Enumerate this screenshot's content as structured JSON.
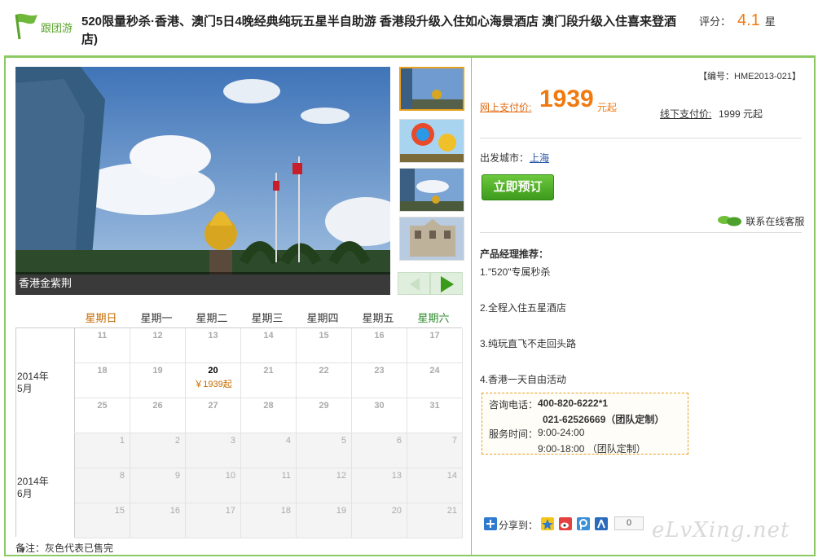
{
  "header": {
    "logo_text": "跟团游",
    "title": "520限量秒杀·香港、澳门5日4晚经典纯玩五星半自助游 香港段升级入住如心海景酒店 澳门段升级入住喜来登酒店)",
    "rating_label": "评分：",
    "rating_score": "4.1",
    "rating_unit": "星"
  },
  "gallery": {
    "caption": "香港金紫荆",
    "thumbnails": [
      "香港金紫荆",
      "热气球",
      "会展中心",
      "大三巴牌坊"
    ]
  },
  "calendar": {
    "weekdays": [
      "星期日",
      "星期一",
      "星期二",
      "星期三",
      "星期四",
      "星期五",
      "星期六"
    ],
    "months": [
      {
        "label_year": "2014年",
        "label_month": "5月",
        "weeks": [
          [
            "11",
            "12",
            "13",
            "14",
            "15",
            "16",
            "17"
          ],
          [
            "18",
            "19",
            "20",
            "21",
            "22",
            "23",
            "24"
          ],
          [
            "25",
            "26",
            "27",
            "28",
            "29",
            "30",
            "31"
          ]
        ]
      },
      {
        "label_year": "2014年",
        "label_month": "6月",
        "weeks": [
          [
            "1",
            "2",
            "3",
            "4",
            "5",
            "6",
            "7"
          ],
          [
            "8",
            "9",
            "10",
            "11",
            "12",
            "13",
            "14"
          ],
          [
            "15",
            "16",
            "17",
            "18",
            "19",
            "20",
            "21"
          ]
        ]
      }
    ],
    "available": {
      "date": "20",
      "price": "￥1939起"
    },
    "up_arrow": "▲",
    "down_arrow": "▼",
    "note": "备注：灰色代表已售完"
  },
  "product": {
    "code": "【编号：HME2013-021】",
    "online_label": "网上支付价:",
    "online_price": "1939",
    "online_unit": "元起",
    "offline_label": "线下支付价:",
    "offline_price": "1999 元起",
    "depart_label": "出发城市：",
    "depart_city": "上海",
    "book_button": "立即预订",
    "service_link": "联系在线客服",
    "pm_title": "产品经理推荐：",
    "pm_items": [
      "1.\"520\"专属秒杀",
      "2.全程入住五星酒店",
      "3.纯玩直飞不走回头路",
      "4.香港一天自由活动"
    ]
  },
  "contact": {
    "phone_label": "咨询电话：",
    "phone1": "400-820-6222*1",
    "phone2": "021-62526669（团队定制）",
    "hours_label": "服务时间：",
    "hours1": "9:00-24:00",
    "hours2": "9:00-18:00 （团队定制）"
  },
  "share": {
    "label": "分享到：",
    "count": "0"
  },
  "watermark": "eLvXing.net",
  "colors": {
    "accent_green": "#8cc963",
    "price_orange": "#f07a10",
    "link_blue": "#2a58a8"
  }
}
